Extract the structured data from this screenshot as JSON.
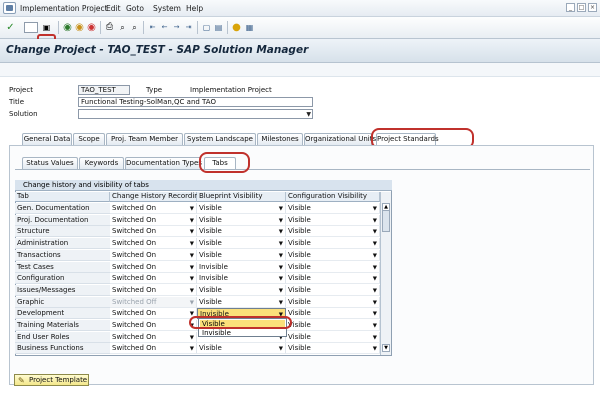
{
  "menu": {
    "items": [
      "Implementation Project",
      "Edit",
      "Goto",
      "System",
      "Help"
    ]
  },
  "toolbar": {
    "icons": [
      "check-icon",
      "save-icon",
      "back-icon",
      "exit-icon",
      "cancel-icon",
      "print-icon",
      "find-icon",
      "find-next-icon",
      "first-page-icon",
      "prev-page-icon",
      "next-page-icon",
      "last-page-icon",
      "new-session-icon",
      "shortcut-icon",
      "help-icon",
      "layout-icon"
    ]
  },
  "title": "Change Project - TAO_TEST - SAP Solution Manager",
  "header": {
    "project_label": "Project",
    "project_value": "TAO_TEST",
    "type_label": "Type",
    "type_value": "Implementation Project",
    "title_label": "Title",
    "title_value": "Functional Testing-SolMan,QC and TAO",
    "solution_label": "Solution",
    "solution_value": ""
  },
  "main_tabs": [
    "General Data",
    "Scope",
    "Proj. Team Member",
    "System Landscape",
    "Milestones",
    "Organizational Units",
    "Project Standards"
  ],
  "main_tab_active": "Project Standards",
  "sub_tabs": [
    "Status Values",
    "Keywords",
    "Documentation Types",
    "Tabs"
  ],
  "sub_tab_active": "Tabs",
  "table": {
    "caption": "Change history and visibility of tabs",
    "columns": [
      "Tab",
      "Change History Recording",
      "Blueprint Visibility",
      "Configuration Visibility"
    ],
    "rows": [
      {
        "tab": "Gen. Documentation",
        "history": "Switched On",
        "blueprint": "Visible",
        "config": "Visible"
      },
      {
        "tab": "Proj. Documentation",
        "history": "Switched On",
        "blueprint": "Visible",
        "config": "Visible"
      },
      {
        "tab": "Structure",
        "history": "Switched On",
        "blueprint": "Visible",
        "config": "Visible"
      },
      {
        "tab": "Administration",
        "history": "Switched On",
        "blueprint": "Visible",
        "config": "Visible"
      },
      {
        "tab": "Transactions",
        "history": "Switched On",
        "blueprint": "Visible",
        "config": "Visible"
      },
      {
        "tab": "Test Cases",
        "history": "Switched On",
        "blueprint": "Invisible",
        "config": "Visible"
      },
      {
        "tab": "Configuration",
        "history": "Switched On",
        "blueprint": "Invisible",
        "config": "Visible"
      },
      {
        "tab": "Issues/Messages",
        "history": "Switched On",
        "blueprint": "Visible",
        "config": "Visible"
      },
      {
        "tab": "Graphic",
        "history": "Switched Off",
        "blueprint": "Visible",
        "config": "Visible"
      },
      {
        "tab": "Development",
        "history": "Switched On",
        "blueprint": "Invisible",
        "config": "Visible"
      },
      {
        "tab": "Training Materials",
        "history": "Switched On",
        "blueprint": "",
        "config": "Visible"
      },
      {
        "tab": "End User Roles",
        "history": "Switched On",
        "blueprint": "",
        "config": "Visible"
      },
      {
        "tab": "Business Functions",
        "history": "Switched On",
        "blueprint": "Visible",
        "config": "Visible"
      }
    ]
  },
  "dropdown": {
    "options": [
      "Visible",
      "Invisible"
    ],
    "highlighted": "Visible"
  },
  "button": {
    "project_template": "Project Template"
  },
  "colors": {
    "highlight_ring": "#c0312c",
    "selected_option": "#fbe07a",
    "title_text": "#15283d"
  }
}
